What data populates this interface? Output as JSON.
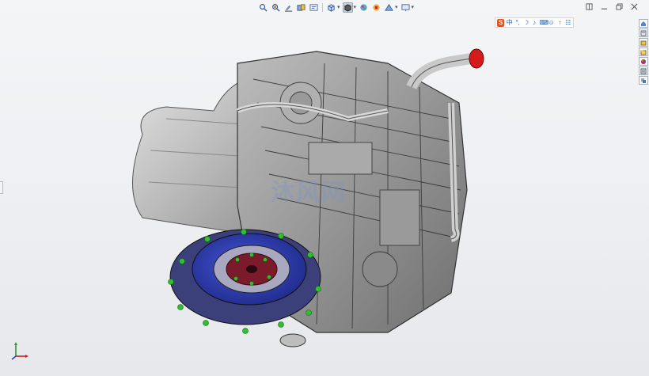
{
  "app": {
    "mode": "3D model viewport",
    "accent": "#1e50c8"
  },
  "hud_toolbar": {
    "items": [
      {
        "icon": "zoom-to-fit-icon"
      },
      {
        "icon": "zoom-to-area-icon"
      },
      {
        "icon": "previous-view-icon"
      },
      {
        "icon": "section-view-icon"
      },
      {
        "icon": "dynamic-annotation-icon"
      },
      {
        "icon": "view-orientation-icon"
      },
      {
        "icon": "display-style-icon"
      },
      {
        "icon": "hide-show-items-icon"
      },
      {
        "icon": "edit-appearance-icon"
      },
      {
        "icon": "apply-scene-icon"
      },
      {
        "icon": "view-settings-icon"
      }
    ]
  },
  "ime": {
    "logo": "S",
    "items": [
      "中",
      "°,",
      "☽",
      "♪",
      "⌨",
      "☺",
      "↑",
      "☷"
    ]
  },
  "taskpane": {
    "items": [
      "home-icon",
      "resources-icon",
      "design-library-icon",
      "file-explorer-icon",
      "appearances-icon",
      "custom-properties-icon",
      "view-palette-icon"
    ]
  },
  "watermark": "沐风网",
  "colors": {
    "engine_body": "#c4c4c4",
    "flywheel": "#2a3aa8",
    "hub": "#7a1a2a",
    "bolts": "#2fbf2f",
    "intake_cap": "#d41a1a"
  }
}
